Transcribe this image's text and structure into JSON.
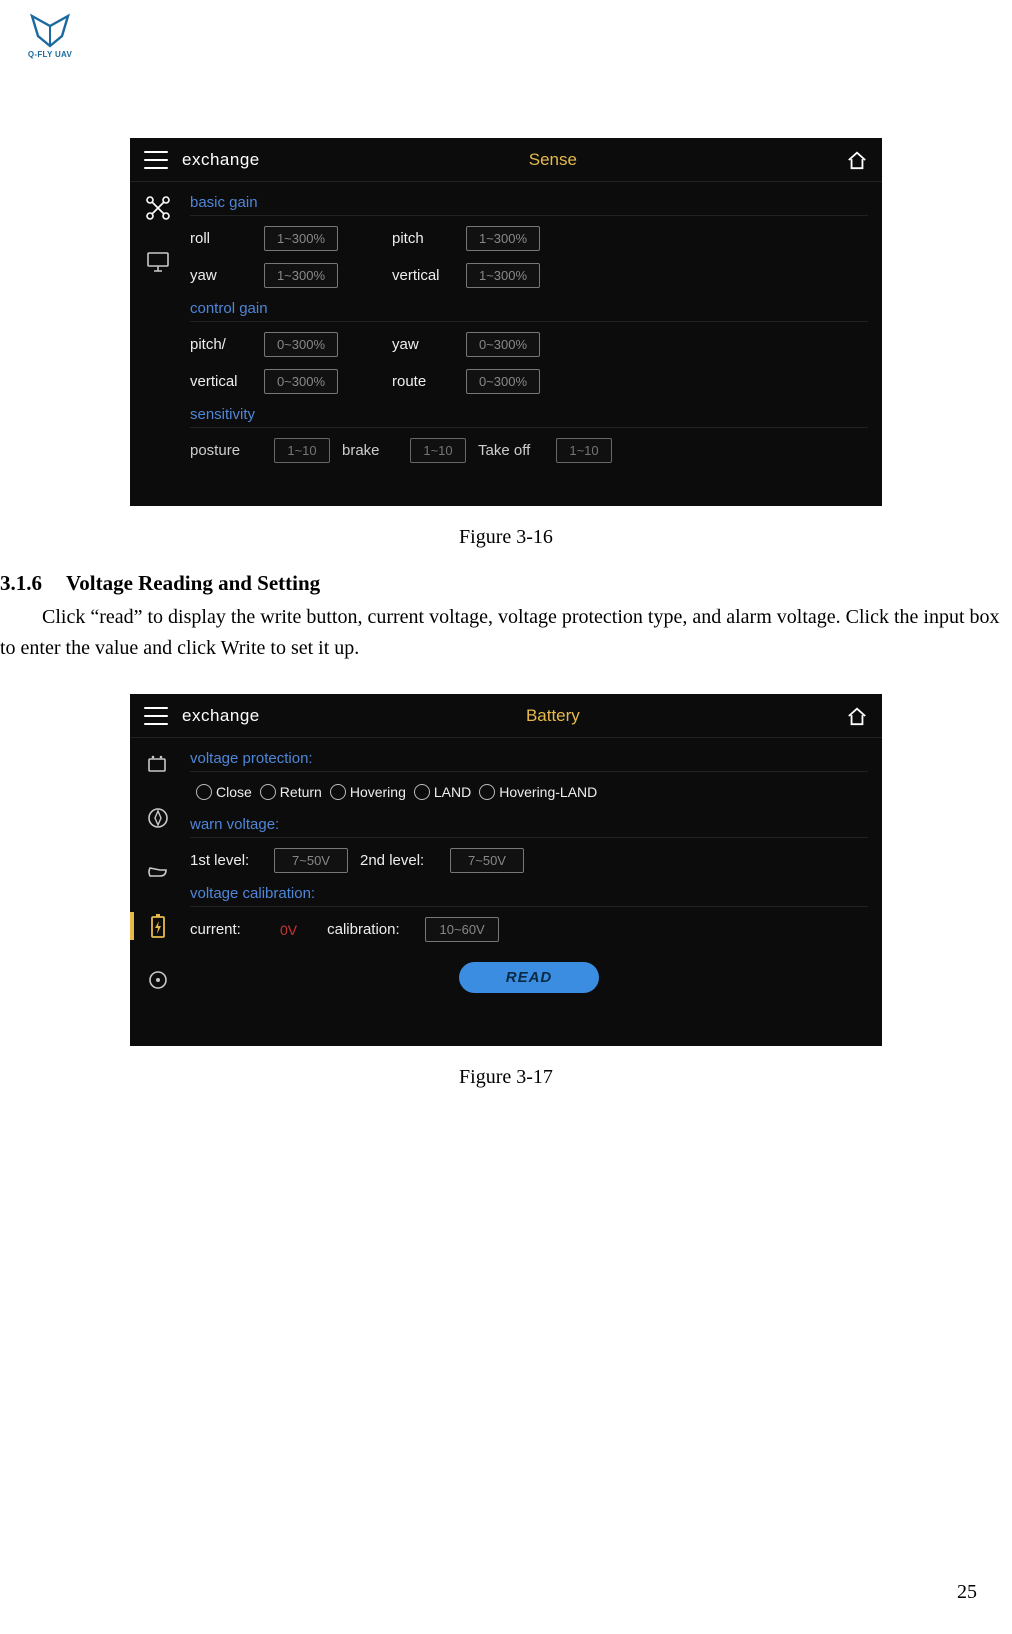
{
  "brand": {
    "name": "Q-FLY UAV"
  },
  "page_number": "25",
  "figure1": {
    "caption": "Figure 3-16",
    "header": {
      "back_label": "exchange",
      "title": "Sense"
    },
    "sections": {
      "basic_gain": {
        "label": "basic gain",
        "roll": {
          "label": "roll",
          "placeholder": "1~300%"
        },
        "pitch": {
          "label": "pitch",
          "placeholder": "1~300%"
        },
        "yaw": {
          "label": "yaw",
          "placeholder": "1~300%"
        },
        "vertical": {
          "label": "vertical",
          "placeholder": "1~300%"
        }
      },
      "control_gain": {
        "label": "control gain",
        "pitch": {
          "label": "pitch/",
          "placeholder": "0~300%"
        },
        "yaw": {
          "label": "yaw",
          "placeholder": "0~300%"
        },
        "vertical": {
          "label": "vertical",
          "placeholder": "0~300%"
        },
        "route": {
          "label": "route",
          "placeholder": "0~300%"
        }
      },
      "sensitivity": {
        "label": "sensitivity",
        "posture": {
          "label": "posture",
          "placeholder": "1~10"
        },
        "brake": {
          "label": "brake",
          "placeholder": "1~10"
        },
        "takeoff": {
          "label": "Take off",
          "placeholder": "1~10"
        }
      }
    }
  },
  "section": {
    "number": "3.1.6",
    "title": "Voltage Reading and Setting",
    "paragraph": "Click “read” to display the write button, current voltage, voltage protection type, and alarm voltage. Click the input box to enter the value and click Write to set it up."
  },
  "figure2": {
    "caption": "Figure 3-17",
    "header": {
      "back_label": "exchange",
      "title": "Battery"
    },
    "voltage_protection": {
      "label": "voltage protection:",
      "options": [
        "Close",
        "Return",
        "Hovering",
        "LAND",
        "Hovering-LAND"
      ]
    },
    "warn_voltage": {
      "label": "warn voltage:",
      "first": {
        "label": "1st level:",
        "placeholder": "7~50V"
      },
      "second": {
        "label": "2nd level:",
        "placeholder": "7~50V"
      }
    },
    "voltage_calibration": {
      "label": "voltage calibration:",
      "current": {
        "label": "current:",
        "value": "0V"
      },
      "calibration": {
        "label": "calibration:",
        "placeholder": "10~60V"
      }
    },
    "read_button": "READ"
  }
}
